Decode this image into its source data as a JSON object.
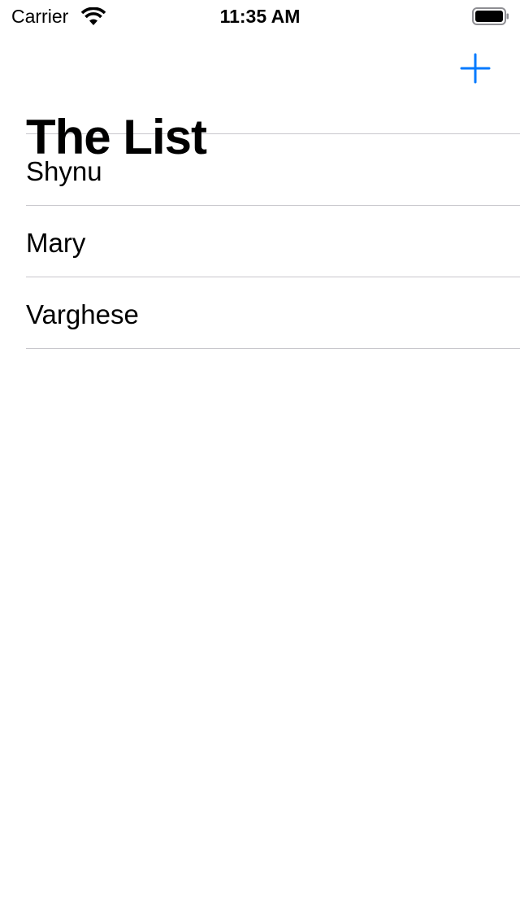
{
  "status_bar": {
    "carrier": "Carrier",
    "time": "11:35 AM"
  },
  "nav": {
    "title": "The List",
    "add_icon": "plus-icon",
    "accent": "#007aff"
  },
  "list": {
    "items": [
      {
        "label": "Shynu"
      },
      {
        "label": "Mary"
      },
      {
        "label": "Varghese"
      }
    ]
  }
}
